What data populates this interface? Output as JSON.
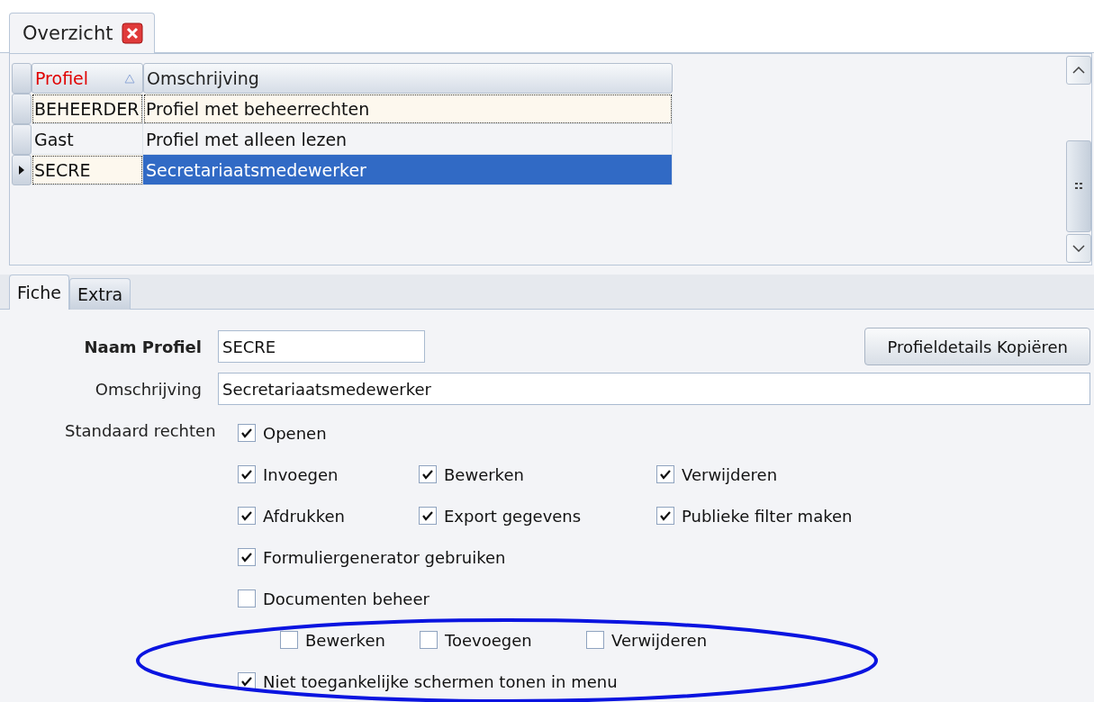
{
  "document_tab": {
    "label": "Overzicht",
    "selected": true
  },
  "grid": {
    "columns": [
      {
        "label": "Profiel",
        "sorted": true
      },
      {
        "label": "Omschrijving",
        "sorted": false
      }
    ],
    "rows": [
      {
        "cells": [
          "BEHEERDER",
          "Profiel met beheerrechten"
        ],
        "selected": false
      },
      {
        "cells": [
          "Gast",
          "Profiel met alleen lezen"
        ],
        "selected": false
      },
      {
        "cells": [
          "SECRE",
          "Secretariaatsmedewerker"
        ],
        "selected": true
      }
    ]
  },
  "detail_tabs": [
    {
      "label": "Fiche",
      "selected": true
    },
    {
      "label": "Extra",
      "selected": false
    }
  ],
  "form": {
    "name_label": "Naam Profiel",
    "name_value": "SECRE",
    "description_label": "Omschrijving",
    "description_value": "Secretariaatsmedewerker",
    "copy_button": "Profieldetails Kopiëren",
    "rights_label": "Standaard rechten",
    "rights": [
      [
        {
          "label": "Openen",
          "checked": true
        }
      ],
      [
        {
          "label": "Invoegen",
          "checked": true
        },
        {
          "label": "Bewerken",
          "checked": true
        },
        {
          "label": "Verwijderen",
          "checked": true
        }
      ],
      [
        {
          "label": "Afdrukken",
          "checked": true
        },
        {
          "label": "Export gegevens",
          "checked": true
        },
        {
          "label": "Publieke filter maken",
          "checked": true
        }
      ],
      [
        {
          "label": "Formuliergenerator gebruiken",
          "checked": true
        }
      ],
      [
        {
          "label": "Documenten beheer",
          "checked": false,
          "children": [
            {
              "label": "Bewerken",
              "checked": false
            },
            {
              "label": "Toevoegen",
              "checked": false
            },
            {
              "label": "Verwijderen",
              "checked": false
            }
          ]
        }
      ],
      [
        {
          "label": "Niet toegankelijke schermen tonen in menu",
          "checked": true
        }
      ]
    ]
  }
}
